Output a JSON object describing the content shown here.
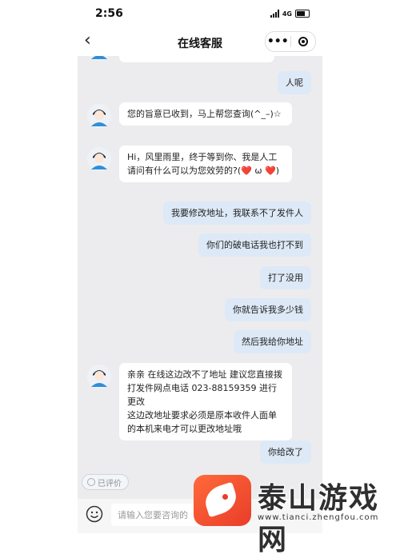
{
  "status_bar": {
    "time": "2:56",
    "network": "4G"
  },
  "navbar": {
    "back_glyph": "‹",
    "title": "在线客服",
    "more_glyph": "•••"
  },
  "colors": {
    "background": "#ececee",
    "bubble_left": "#ffffff",
    "bubble_right": "#dde9f7",
    "watermark_accent": "#e93d29"
  },
  "messages": [
    {
      "side": "left",
      "text": ""
    },
    {
      "side": "right",
      "text": "人呢"
    },
    {
      "side": "left",
      "text": "您的旨意已收到，马上帮您查询(^_–)☆"
    },
    {
      "side": "left",
      "text": "Hi，风里雨里，终于等到你、我是人工请问有什么可以为您效劳的?(❤️ ω ❤️)"
    },
    {
      "side": "right",
      "text": "我要修改地址，我联系不了发件人"
    },
    {
      "side": "right",
      "text": "你们的破电话我也打不到"
    },
    {
      "side": "right",
      "text": "打了没用"
    },
    {
      "side": "right",
      "text": "你就告诉我多少钱"
    },
    {
      "side": "right",
      "text": "然后我给你地址"
    },
    {
      "side": "left",
      "text": "亲亲  在线这边改不了地址  建议您直接拨打发件网点电话 023-88159359 进行更改\n这边改地址要求必须是原本收件人面单的本机来电才可以更改地址哦"
    },
    {
      "side": "right",
      "text": "你给改了"
    }
  ],
  "rate_button": {
    "label": "已评价"
  },
  "input": {
    "placeholder": "请输入您要咨询的",
    "emoji_icon": "smiley-icon"
  },
  "watermark": {
    "text": "泰山游戏网",
    "url": "www.tianci.zhengfou.com"
  }
}
